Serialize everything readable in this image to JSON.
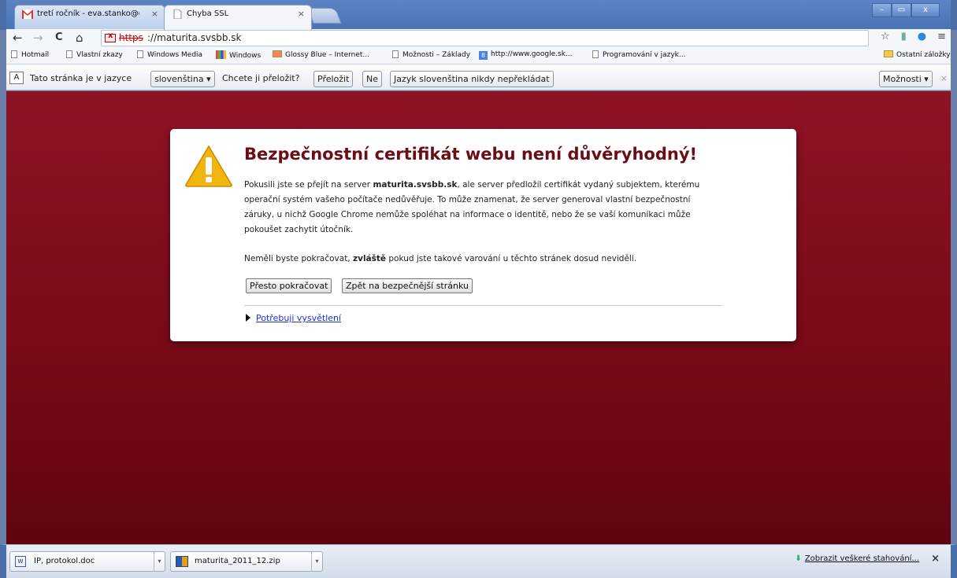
{
  "tabs": [
    {
      "label": "tretí ročník - eva.stanko@gm",
      "close": "×",
      "icon": "gmail-icon",
      "active": false
    },
    {
      "label": "Chyba SSL",
      "close": "×",
      "icon": "page-icon",
      "active": true
    }
  ],
  "window_controls": {
    "minimize": "–",
    "maximize": "▭",
    "close": "x"
  },
  "toolbar": {
    "back": "←",
    "forward": "→",
    "reload": "C",
    "home": "⌂",
    "url_scheme": "https",
    "url_rest": "://maturita.svsbb.sk"
  },
  "bookmarks": [
    {
      "label": "Hotmail",
      "icon": "page-icon"
    },
    {
      "label": "Vlastní zkazy",
      "icon": "page-icon"
    },
    {
      "label": "Windows Media",
      "icon": "page-icon"
    },
    {
      "label": "Windows",
      "icon": "windows-icon"
    },
    {
      "label": "Glossy Blue – Internet...",
      "icon": "glossy-icon"
    },
    {
      "label": "Možnosti – Základy",
      "icon": "page-icon"
    },
    {
      "label": "http://www.google.sk...",
      "icon": "google-icon"
    },
    {
      "label": "Programování v jazyk...",
      "icon": "page-icon"
    }
  ],
  "other_bookmarks": "Ostatní záložky",
  "translate": {
    "prefix": "Tato stránka je v jazyce",
    "language": "slovenština",
    "question": "Chcete ji přeložit?",
    "translate_btn": "Přeložit",
    "no_btn": "Ne",
    "never_btn": "Jazyk slovenština nikdy nepřekládat",
    "options_btn": "Možnosti",
    "close": "×"
  },
  "interstitial": {
    "heading": "Bezpečnostní certifikát webu není důvěryhodný!",
    "p1_a": "Pokusili jste se přejít na server ",
    "p1_host": "maturita.svsbb.sk",
    "p1_b": ", ale server předložil certifikát vydaný subjektem, kterému operační systém vašeho počítače nedůvěřuje. To může znamenat, že server generoval vlastní bezpečnostní záruky, u nichž Google Chrome nemůže spoléhat na informace o identitě, nebo že se vaší komunikaci může pokoušet zachytit útočník.",
    "p2_a": "Neměli byste pokračovat, ",
    "p2_bold": "zvláště",
    "p2_b": " pokud jste takové varování u těchto stránek dosud neviděli.",
    "proceed_btn": "Přesto pokračovat",
    "back_btn": "Zpět na bezpečnější stránku",
    "more_link": "Potřebuji vysvětlení"
  },
  "downloads": [
    {
      "name": "IP, protokol.doc",
      "icon": "word-doc-icon"
    },
    {
      "name": "maturita_2011_12.zip",
      "icon": "zip-icon"
    }
  ],
  "show_all_downloads": "Zobrazit veškeré stahování...",
  "shelf_close": "×",
  "colors": {
    "page_bg": "#7a0a18",
    "heading": "#6b0d14",
    "link": "#1a34c8",
    "frame": "#4a73b6"
  }
}
